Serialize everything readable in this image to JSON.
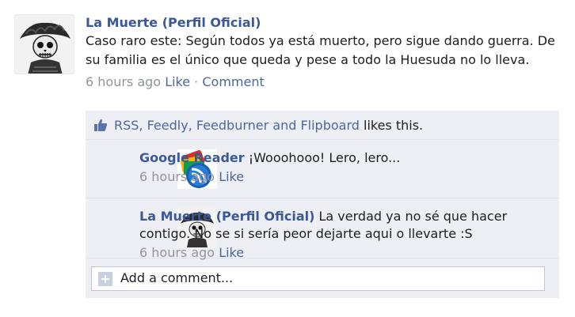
{
  "post": {
    "author": "La Muerte (Perfil Oficial)",
    "text": "Caso raro este: Según todos ya está muerto, pero sigue dando guerra. De su familia es el único que queda y pese a todo la Huesuda no lo lleva.",
    "time": "6 hours ago",
    "sep": " · ",
    "like_label": "Like",
    "comment_label": "Comment"
  },
  "likes": {
    "names": "RSS, Feedly, Feedburner and Flipboard",
    "suffix": " likes this.",
    "icon": "thumbs-up-icon"
  },
  "comments": [
    {
      "author": "Google Reader",
      "text": " ¡Wooohooo! Lero, lero...",
      "time": "6 hours ago",
      "like_label": "Like",
      "avatar": "google-reader-logo"
    },
    {
      "author": "La Muerte (Perfil Oficial)",
      "text": " La verdad ya no sé que hacer contigo. No se si sería peor dejarte aqui o llevarte :S",
      "time": "6 hours ago",
      "like_label": "Like",
      "avatar": "catrina-skull-engraving"
    }
  ],
  "add_comment": {
    "placeholder": "Add a comment...",
    "icon": "plus-icon"
  },
  "colors": {
    "link": "#3b5998",
    "muted": "#90949c",
    "feedback_bg": "#edeff4"
  }
}
